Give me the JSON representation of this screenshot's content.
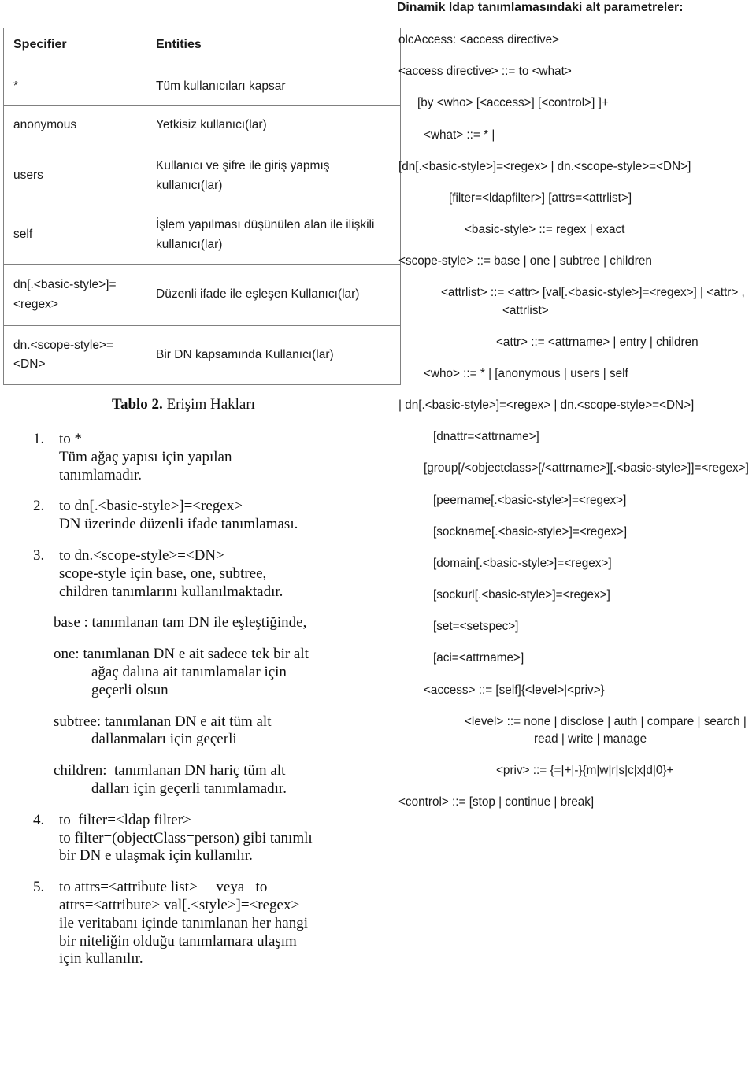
{
  "table": {
    "headers": [
      "Specifier",
      "Entities"
    ],
    "rows": [
      {
        "specifier": "*",
        "entities": "Tüm kullanıcıları kapsar"
      },
      {
        "specifier": "anonymous",
        "entities": "Yetkisiz kullanıcı(lar)"
      },
      {
        "specifier": "users",
        "entities": "Kullanıcı ve şifre ile giriş yapmış kullanıcı(lar)"
      },
      {
        "specifier": "self",
        "entities": "İşlem yapılması düşünülen alan ile ilişkili kullanıcı(lar)"
      },
      {
        "specifier": "dn[.<basic-style>]=<regex>",
        "entities": "Düzenli ifade ile eşleşen Kullanıcı(lar)"
      },
      {
        "specifier": "dn.<scope-style>=<DN>",
        "entities": "Bir DN kapsamında Kullanıcı(lar)"
      }
    ],
    "caption_label": "Tablo 2.",
    "caption_text": " Erişim Hakları"
  },
  "list": {
    "items": [
      {
        "number": "1.",
        "lines": [
          "to *",
          "Tüm ağaç yapısı için yapılan",
          "tanımlamadır."
        ]
      },
      {
        "number": "2.",
        "lines": [
          "to dn[.<basic-style>]=<regex>",
          "DN üzerinde düzenli ifade tanımlaması."
        ]
      },
      {
        "number": "3.",
        "lines": [
          "to dn.<scope-style>=<DN>",
          "scope-style için base, one, subtree,",
          "children tanımlarını kullanılmaktadır."
        ]
      }
    ],
    "paragraphs": [
      {
        "lines": [
          "base : tanımlanan tam DN ile eşleştiğinde,"
        ],
        "indented": []
      },
      {
        "lines": [
          "one: tanımlanan DN e ait sadece tek bir alt"
        ],
        "indented": [
          "ağaç dalına ait tanımlamalar için",
          "geçerli olsun"
        ]
      },
      {
        "lines": [
          "subtree: tanımlanan DN e ait tüm alt"
        ],
        "indented": [
          "dallanmaları için geçerli"
        ]
      },
      {
        "lines": [
          "children:  tanımlanan DN hariç tüm alt"
        ],
        "indented": [
          "dalları için geçerli tanımlamadır."
        ]
      }
    ],
    "items2": [
      {
        "number": "4.",
        "lines": [
          "to  filter=<ldap filter>",
          "to filter=(objectClass=person) gibi tanımlı",
          "bir DN e ulaşmak için kullanılır."
        ]
      },
      {
        "number": "5.",
        "lines": [
          "to attrs=<attribute list>     veya   to",
          "attrs=<attribute> val[.<style>]=<regex>",
          "ile veritabanı içinde tanımlanan her hangi",
          "bir niteliğin olduğu tanımlamara ulaşım",
          "için kullanılır."
        ]
      }
    ]
  },
  "right": {
    "title": "Dinamik ldap tanımlamasındaki alt parametreler:",
    "lines": [
      {
        "text": "olcAccess: <access directive>",
        "indent": "i0"
      },
      {
        "text": "<access directive> ::= to <what>",
        "indent": "i0"
      },
      {
        "text": "[by <who> [<access>] [<control>] ]+",
        "indent": "i1"
      },
      {
        "text": "<what> ::= * |",
        "indent": "i2"
      },
      {
        "text": "[dn[.<basic-style>]=<regex> | dn.<scope-style>=<DN>]",
        "indent": "hang"
      },
      {
        "text": "[filter=<ldapfilter>] [attrs=<attrlist>]",
        "indent": "i3"
      },
      {
        "text": "<basic-style> ::= regex | exact",
        "indent": "i4"
      },
      {
        "text": "<scope-style> ::= base | one | subtree | children",
        "indent": "hang5"
      },
      {
        "text": "<attrlist> ::= <attr> [val[.<basic-style>]=<regex>] | <attr> , <attrlist>",
        "indent": "hang7"
      },
      {
        "text": "<attr> ::= <attrname> | entry | children",
        "indent": "hang6"
      },
      {
        "text": "<who> ::= * | [anonymous | users | self",
        "indent": "i2"
      },
      {
        "text": "| dn[.<basic-style>]=<regex> | dn.<scope-style>=<DN>]",
        "indent": "hang2"
      },
      {
        "text": "[dnattr=<attrname>]",
        "indent": "i7"
      },
      {
        "text": "[group[/<objectclass>[/<attrname>][.<basic-style>]]=<regex>]",
        "indent": "hang3"
      },
      {
        "text": "[peername[.<basic-style>]=<regex>]",
        "indent": "i7"
      },
      {
        "text": "[sockname[.<basic-style>]=<regex>]",
        "indent": "i7"
      },
      {
        "text": "[domain[.<basic-style>]=<regex>]",
        "indent": "i7"
      },
      {
        "text": "[sockurl[.<basic-style>]=<regex>]",
        "indent": "i7"
      },
      {
        "text": "[set=<setspec>]",
        "indent": "i7"
      },
      {
        "text": "[aci=<attrname>]",
        "indent": "i7"
      },
      {
        "text": "<access> ::= [self]{<level>|<priv>}",
        "indent": "i2"
      },
      {
        "text": "<level> ::= none | disclose | auth | compare | search | read | write | manage",
        "indent": "hang4"
      },
      {
        "text": "<priv> ::= {=|+|-}{m|w|r|s|c|x|d|0}+",
        "indent": "i5"
      },
      {
        "text": "<control> ::= [stop | continue | break]",
        "indent": "i0"
      }
    ]
  },
  "colors": {
    "text": "#1a1a1a",
    "border": "#808080",
    "background": "#ffffff"
  }
}
